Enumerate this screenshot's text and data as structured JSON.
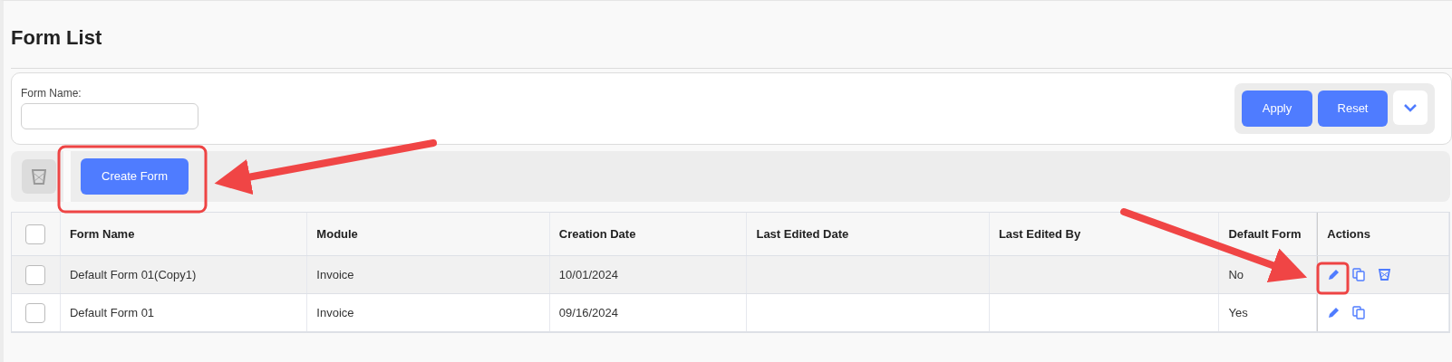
{
  "page": {
    "title": "Form List"
  },
  "filter": {
    "label": "Form Name:",
    "buttons": [
      {
        "kind": "apply",
        "label": "Apply"
      },
      {
        "kind": "reset",
        "label": "Reset"
      },
      {
        "kind": "expand"
      }
    ]
  },
  "toolbar": {
    "create_button": "Create Form"
  },
  "table": {
    "columns": [
      "Form Name",
      "Module",
      "Creation Date",
      "Last Edited Date",
      "Last Edited By",
      "Default Form",
      "Actions"
    ],
    "header_checked": false,
    "rows": [
      {
        "checked": false,
        "highlighted": true,
        "cells": [
          "Default Form 01(Copy1)",
          "Invoice",
          "10/01/2024",
          "",
          "",
          "No"
        ],
        "actions": [
          {
            "kind": "edit"
          },
          {
            "kind": "copy"
          },
          {
            "kind": "delete"
          }
        ]
      },
      {
        "checked": false,
        "highlighted": false,
        "cells": [
          "Default Form 01",
          "Invoice",
          "09/16/2024",
          "",
          "",
          "Yes"
        ],
        "actions": [
          {
            "kind": "edit"
          },
          {
            "kind": "copy"
          }
        ]
      }
    ]
  }
}
